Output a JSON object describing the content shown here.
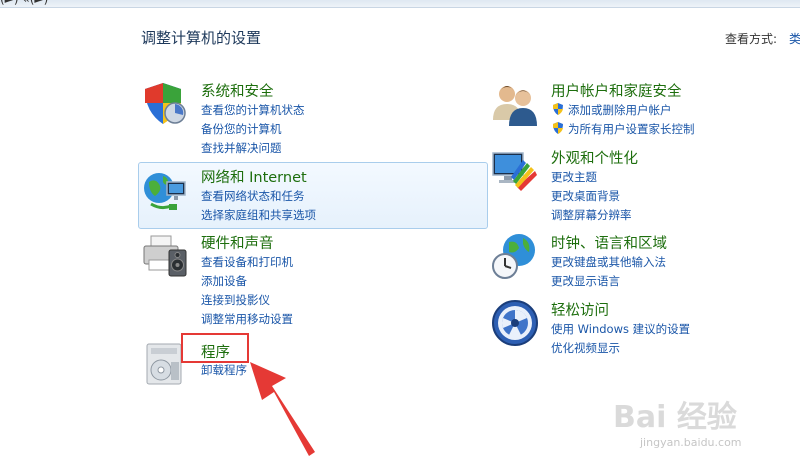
{
  "topbar": {
    "crumb": "(►) «(►)"
  },
  "header": {
    "title": "调整计算机的设置",
    "view_label": "查看方式:",
    "view_value": "类"
  },
  "left_categories": [
    {
      "title": "系统和安全",
      "links": [
        "查看您的计算机状态",
        "备份您的计算机",
        "查找并解决问题"
      ]
    },
    {
      "title": "网络和 Internet",
      "links": [
        "查看网络状态和任务",
        "选择家庭组和共享选项"
      ]
    },
    {
      "title": "硬件和声音",
      "links": [
        "查看设备和打印机",
        "添加设备",
        "连接到投影仪",
        "调整常用移动设置"
      ]
    },
    {
      "title": "程序",
      "links": [
        "卸载程序"
      ]
    }
  ],
  "right_categories": [
    {
      "title": "用户帐户和家庭安全",
      "links": [
        "添加或删除用户帐户",
        "为所有用户设置家长控制"
      ]
    },
    {
      "title": "外观和个性化",
      "links": [
        "更改主题",
        "更改桌面背景",
        "调整屏幕分辨率"
      ]
    },
    {
      "title": "时钟、语言和区域",
      "links": [
        "更改键盘或其他输入法",
        "更改显示语言"
      ]
    },
    {
      "title": "轻松访问",
      "links": [
        "使用 Windows 建议的设置",
        "优化视频显示"
      ]
    }
  ],
  "watermark": {
    "text": "Bai 经验",
    "sub": "jingyan.baidu.com"
  },
  "colors": {
    "title_green": "#1d6e0d",
    "link_blue": "#1a56a8",
    "annotation_red": "#e53935"
  }
}
